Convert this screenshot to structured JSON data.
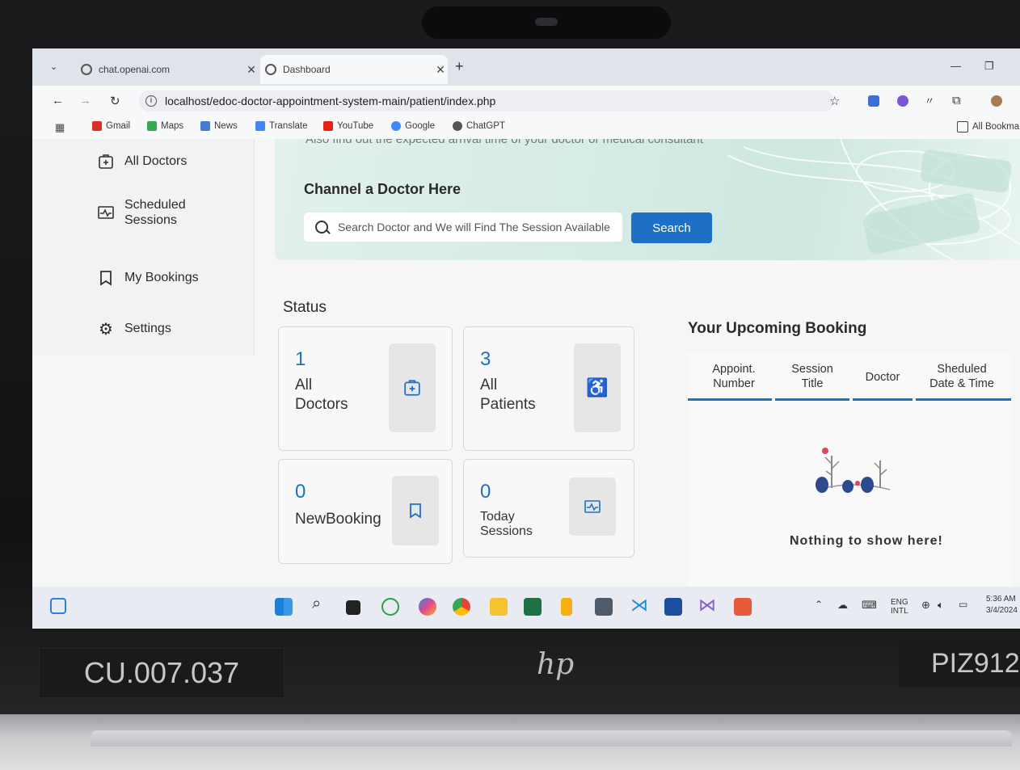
{
  "device": {
    "asset_tag": "CU.007.037",
    "right_label": "PIZ912",
    "logo": "hp"
  },
  "browser": {
    "tabs": [
      {
        "title": "chat.openai.com",
        "active": false
      },
      {
        "title": "Dashboard",
        "active": true
      }
    ],
    "url": "localhost/edoc-doctor-appointment-system-main/patient/index.php",
    "bookmarks": [
      "Gmail",
      "Maps",
      "News",
      "Translate",
      "YouTube",
      "Google",
      "ChatGPT"
    ],
    "all_bookmarks": "All Bookma"
  },
  "sidebar": {
    "items": [
      {
        "label": "All Doctors",
        "icon": "doctor-plus-icon"
      },
      {
        "label": "Scheduled\nSessions",
        "icon": "session-chart-icon"
      },
      {
        "label": "My Bookings",
        "icon": "bookmark-icon"
      },
      {
        "label": "Settings",
        "icon": "gear-icon"
      }
    ]
  },
  "hero": {
    "cut_text": "Also find out the expected arrival time of your doctor or medical consultant",
    "title": "Channel a Doctor Here",
    "search_placeholder": "Search Doctor and We will Find The Session Available",
    "search_button": "Search"
  },
  "status": {
    "label": "Status",
    "cards": [
      {
        "value": "1",
        "label": "All\nDoctors",
        "icon": "doctor-plus-icon"
      },
      {
        "value": "3",
        "label": "All\nPatients",
        "icon": "wheelchair-icon"
      },
      {
        "value": "0",
        "label": "NewBooking",
        "icon": "bookmark-icon"
      },
      {
        "value": "0",
        "label": "Today\nSessions",
        "icon": "session-chart-icon"
      }
    ]
  },
  "upcoming": {
    "title": "Your Upcoming Booking",
    "columns": [
      "Appoint.\nNumber",
      "Session\nTitle",
      "Doctor",
      "Sheduled\nDate & Time"
    ],
    "empty_text": "Nothing to show here!"
  },
  "taskbar": {
    "language": "ENG\nINTL",
    "time": "5:36 AM",
    "date": "3/4/2024"
  },
  "colors": {
    "accent": "#1e6fc6",
    "hero_bg": "#d6ece6"
  }
}
